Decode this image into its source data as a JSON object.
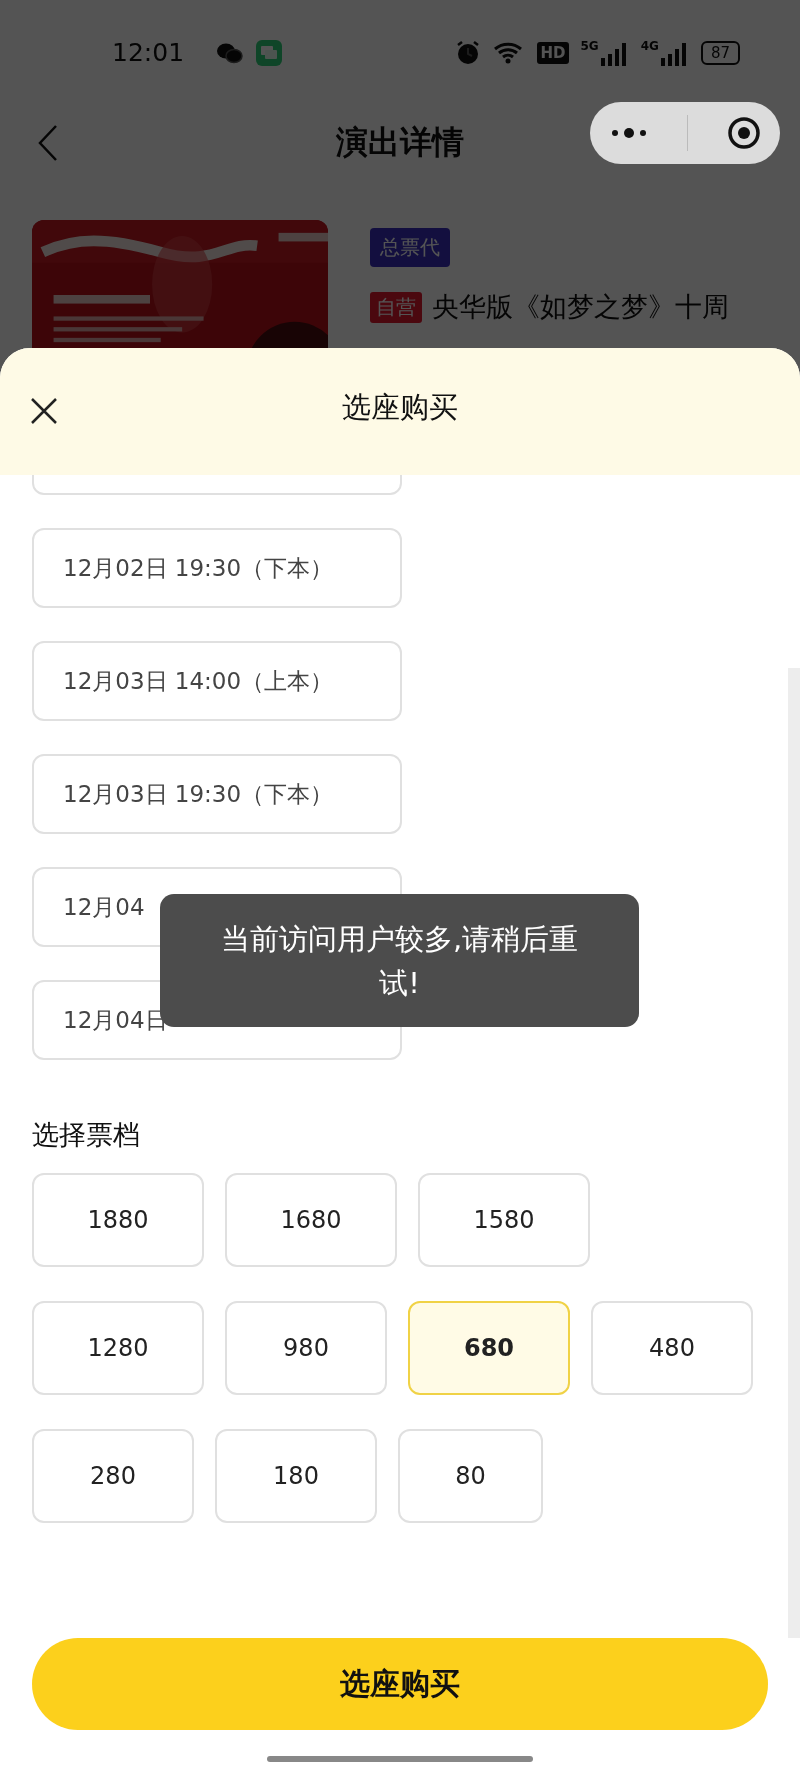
{
  "status_bar": {
    "time": "12:01",
    "hd": "HD",
    "signal_1": "5G",
    "signal_2": "4G",
    "battery": "87"
  },
  "nav": {
    "title": "演出详情"
  },
  "show": {
    "agency_badge": "总票代",
    "tag": "自营",
    "title": "央华版《如梦之梦》十周"
  },
  "sheet": {
    "title": "选座购买",
    "sessions": [
      {
        "label": "12月02日 19:30（下本）"
      },
      {
        "label": "12月03日 14:00（上本）"
      },
      {
        "label": "12月03日 19:30（下本）"
      },
      {
        "label": "12月04"
      },
      {
        "label": "12月04日"
      }
    ],
    "tier_heading": "选择票档",
    "tier_rows": [
      [
        {
          "label": "1880",
          "selected": false
        },
        {
          "label": "1680",
          "selected": false
        },
        {
          "label": "1580",
          "selected": false
        }
      ],
      [
        {
          "label": "1280",
          "selected": false
        },
        {
          "label": "980",
          "selected": false
        },
        {
          "label": "680",
          "selected": true
        },
        {
          "label": "480",
          "selected": false
        }
      ],
      [
        {
          "label": "280",
          "selected": false
        },
        {
          "label": "180",
          "selected": false
        },
        {
          "label": "80",
          "selected": false
        }
      ]
    ],
    "buy_button": "选座购买"
  },
  "toast": "当前访问用户较多,请稍后重试!"
}
